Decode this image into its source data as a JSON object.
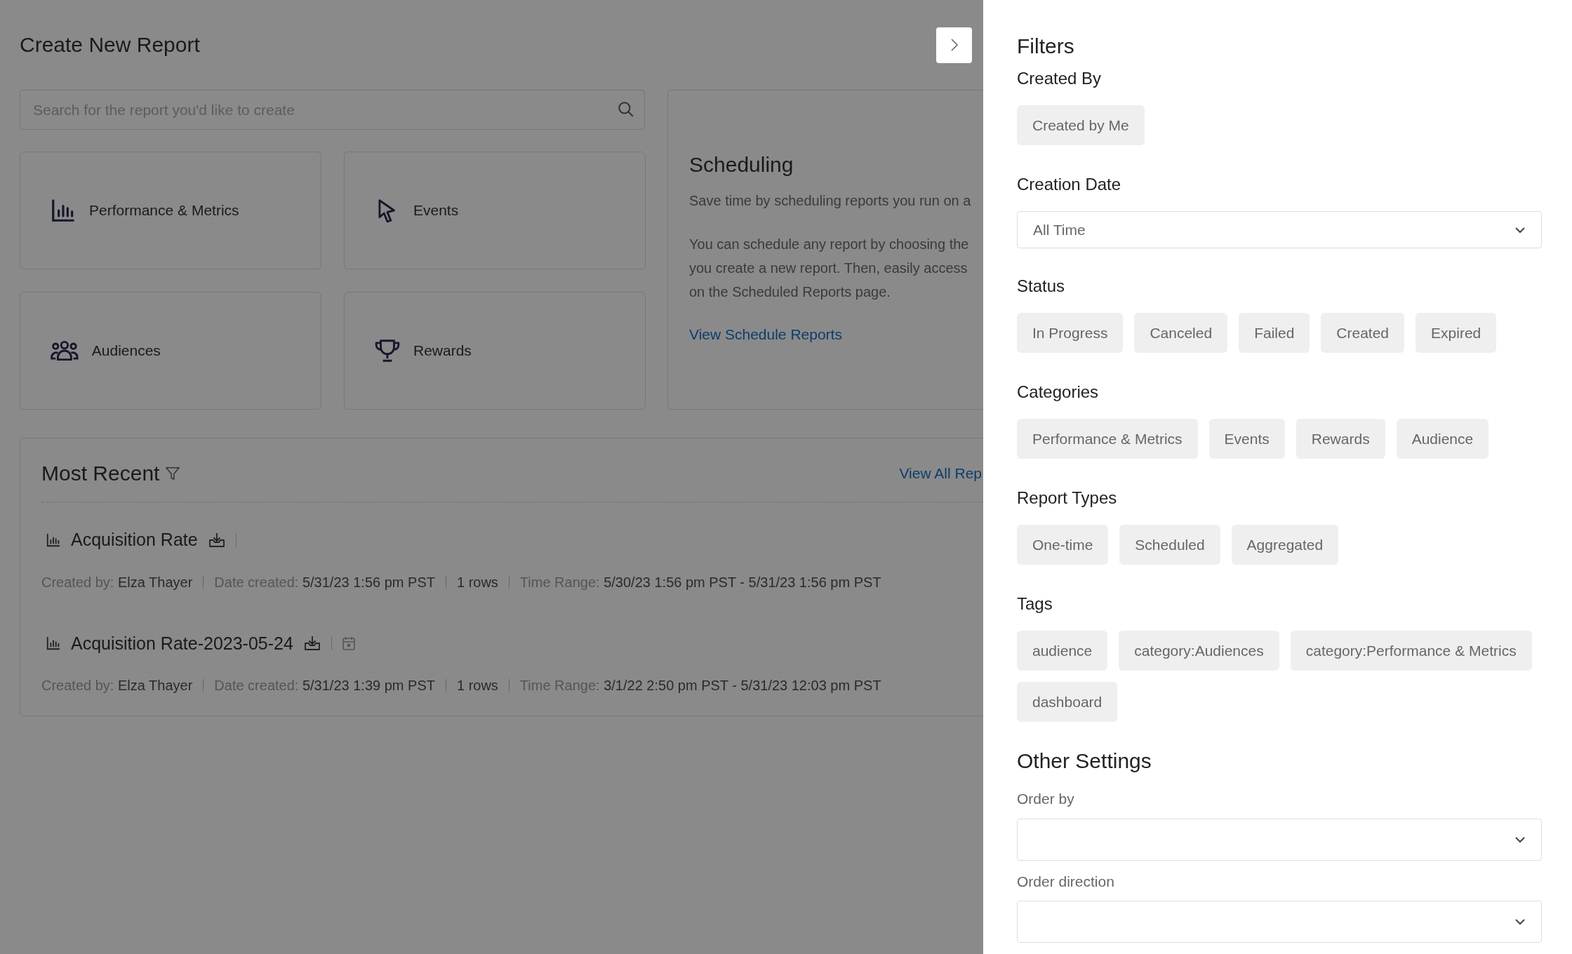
{
  "page": {
    "title": "Create New Report",
    "search": {
      "placeholder": "Search for the report you'd like to create"
    },
    "tiles": [
      {
        "kind": "chart",
        "label": "Performance & Metrics"
      },
      {
        "kind": "cursor",
        "label": "Events"
      },
      {
        "kind": "people",
        "label": "Audiences"
      },
      {
        "kind": "trophy",
        "label": "Rewards"
      }
    ],
    "scheduling": {
      "title": "Scheduling",
      "intro": "Save time by scheduling reports you run on a",
      "body_lines": [
        "You can schedule any report by choosing the",
        "you create a new report. Then, easily access",
        "on the Scheduled Reports page."
      ],
      "link": "View Schedule Reports"
    },
    "recent": {
      "title": "Most Recent",
      "view_all": "View All Rep",
      "reports": [
        {
          "title": "Acquisition Rate",
          "scheduled": false,
          "meta": [
            {
              "label": "Created by:",
              "value": "Elza Thayer"
            },
            {
              "label": "Date created:",
              "value": "5/31/23 1:56 pm PST"
            },
            {
              "value": "1 rows"
            },
            {
              "label": "Time Range:",
              "value": "5/30/23 1:56 pm PST - 5/31/23 1:56 pm PST"
            }
          ]
        },
        {
          "title": "Acquisition Rate-2023-05-24",
          "scheduled": true,
          "meta": [
            {
              "label": "Created by:",
              "value": "Elza Thayer"
            },
            {
              "label": "Date created:",
              "value": "5/31/23 1:39 pm PST"
            },
            {
              "value": "1 rows"
            },
            {
              "label": "Time Range:",
              "value": "3/1/22 2:50 pm PST - 5/31/23 12:03 pm PST"
            }
          ]
        }
      ]
    }
  },
  "filters": {
    "title": "Filters",
    "sections": [
      {
        "kind": "chips",
        "label": "Created By",
        "options": [
          "Created by Me"
        ]
      },
      {
        "kind": "select",
        "label": "Creation Date",
        "value": "All Time"
      },
      {
        "kind": "chips",
        "label": "Status",
        "options": [
          "In Progress",
          "Canceled",
          "Failed",
          "Created",
          "Expired"
        ]
      },
      {
        "kind": "chips",
        "label": "Categories",
        "options": [
          "Performance & Metrics",
          "Events",
          "Rewards",
          "Audience"
        ]
      },
      {
        "kind": "chips",
        "label": "Report Types",
        "options": [
          "One-time",
          "Scheduled",
          "Aggregated"
        ]
      },
      {
        "kind": "chips",
        "label": "Tags",
        "options": [
          "audience",
          "category:Audiences",
          "category:Performance & Metrics",
          "dashboard"
        ]
      }
    ],
    "other_settings": {
      "title": "Other Settings",
      "fields": [
        {
          "label": "Order by"
        },
        {
          "label": "Order direction"
        }
      ]
    }
  }
}
